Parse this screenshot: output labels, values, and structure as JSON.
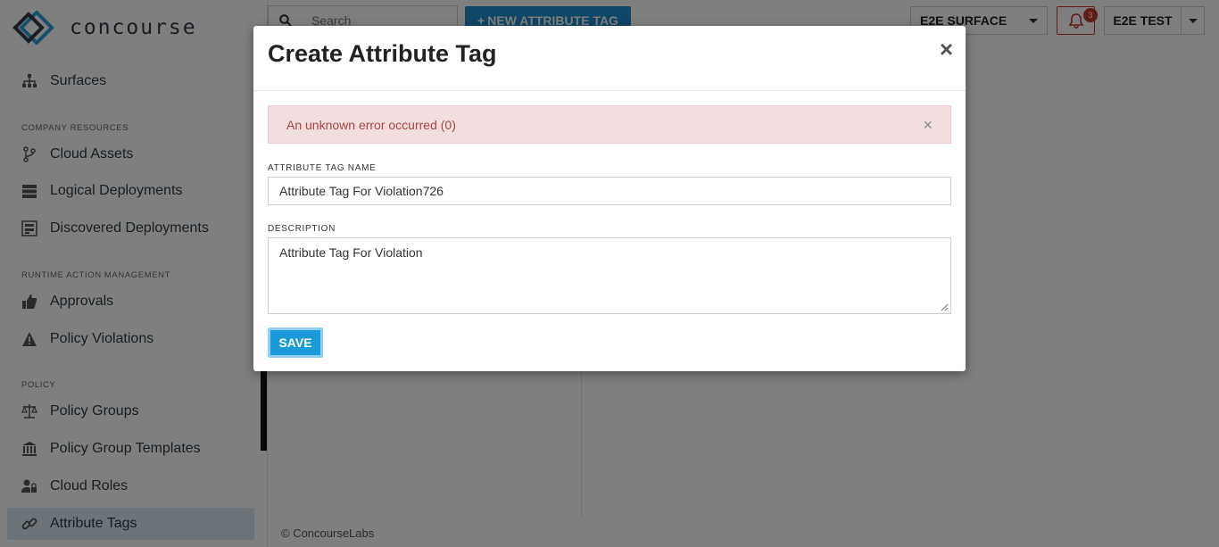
{
  "app": {
    "logo_text": "concourse"
  },
  "sidebar": {
    "items": [
      {
        "label": "Surfaces",
        "icon": "sitemap-icon"
      },
      {
        "label": "Cloud Assets",
        "icon": "branch-icon"
      },
      {
        "label": "Logical Deployments",
        "icon": "server-icon"
      },
      {
        "label": "Discovered Deployments",
        "icon": "scan-icon"
      },
      {
        "label": "Approvals",
        "icon": "thumbs-up-icon"
      },
      {
        "label": "Policy Violations",
        "icon": "warning-icon"
      },
      {
        "label": "Policy Groups",
        "icon": "balance-scale-icon"
      },
      {
        "label": "Policy Group Templates",
        "icon": "institution-icon"
      },
      {
        "label": "Cloud Roles",
        "icon": "user-lock-icon"
      },
      {
        "label": "Attribute Tags",
        "icon": "link-icon"
      }
    ],
    "sections": {
      "company_resources": "COMPANY RESOURCES",
      "runtime_action_management": "RUNTIME ACTION MANAGEMENT",
      "policy": "POLICY"
    }
  },
  "topbar": {
    "search_placeholder": "Search",
    "new_button_label": "NEW ATTRIBUTE TAG",
    "surface_select": "E2E SURFACE",
    "notification_count": "3",
    "user_label": "E2E TEST"
  },
  "footer": {
    "text": "© ConcourseLabs"
  },
  "modal": {
    "title": "Create Attribute Tag",
    "close_glyph": "×",
    "alert_text": "An unknown error occurred (0)",
    "alert_close_glyph": "×",
    "name_label": "ATTRIBUTE TAG NAME",
    "name_value": "Attribute Tag For Violation726",
    "description_label": "DESCRIPTION",
    "description_value": "Attribute Tag For Violation",
    "save_label": "SAVE"
  },
  "colors": {
    "accent": "#1f8fcf",
    "alert_bg": "#f2dede",
    "alert_text": "#a94442",
    "active_nav": "#d8e9f2",
    "bell": "#c0392b"
  }
}
